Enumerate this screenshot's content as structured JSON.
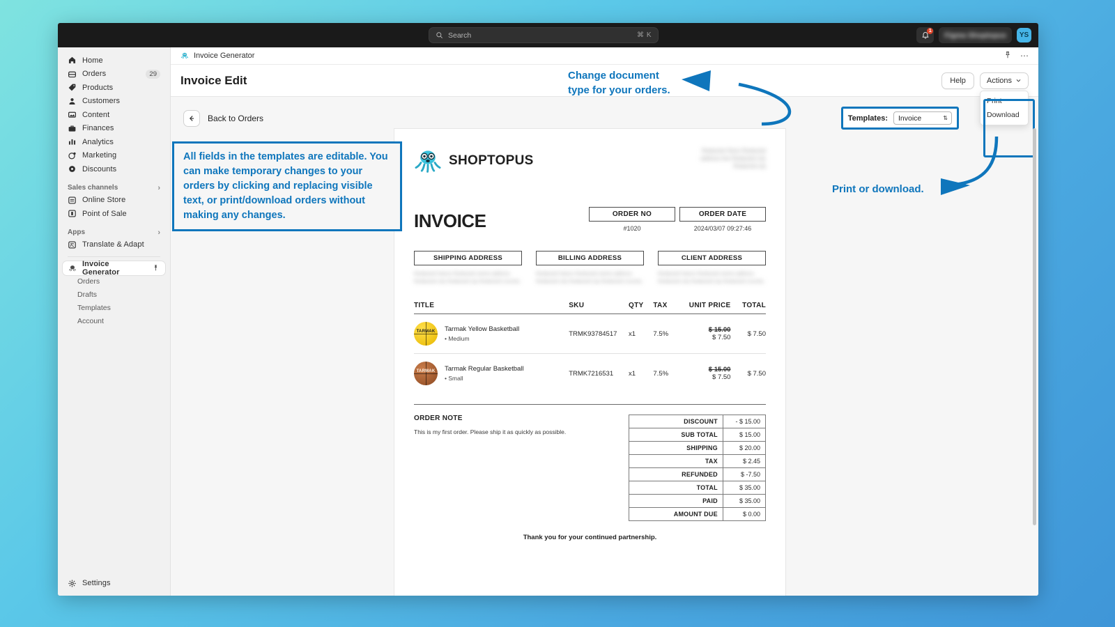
{
  "topbar": {
    "search_placeholder": "Search",
    "search_shortcut": "⌘ K",
    "notification_count": "1",
    "store_name": "Figma Shoptopus",
    "avatar_initials": "YS"
  },
  "sidebar": {
    "items": [
      {
        "label": "Home",
        "icon": "home-icon",
        "badge": ""
      },
      {
        "label": "Orders",
        "icon": "orders-icon",
        "badge": "29"
      },
      {
        "label": "Products",
        "icon": "products-icon",
        "badge": ""
      },
      {
        "label": "Customers",
        "icon": "customers-icon",
        "badge": ""
      },
      {
        "label": "Content",
        "icon": "content-icon",
        "badge": ""
      },
      {
        "label": "Finances",
        "icon": "finances-icon",
        "badge": ""
      },
      {
        "label": "Analytics",
        "icon": "analytics-icon",
        "badge": ""
      },
      {
        "label": "Marketing",
        "icon": "marketing-icon",
        "badge": ""
      },
      {
        "label": "Discounts",
        "icon": "discounts-icon",
        "badge": ""
      }
    ],
    "groups": [
      {
        "label": "Sales channels",
        "items": [
          {
            "label": "Online Store",
            "icon": "online-store-icon"
          },
          {
            "label": "Point of Sale",
            "icon": "point-of-sale-icon"
          }
        ]
      },
      {
        "label": "Apps",
        "items": [
          {
            "label": "Translate & Adapt",
            "icon": "translate-adapt-icon"
          }
        ]
      }
    ],
    "app": {
      "label": "Invoice Generator",
      "icon": "octopus-icon",
      "pin_icon": "pin-icon",
      "subitems": [
        "Orders",
        "Drafts",
        "Templates",
        "Account"
      ]
    },
    "settings": {
      "label": "Settings",
      "icon": "gear-icon"
    }
  },
  "app_header": {
    "breadcrumb": "Invoice Generator",
    "pin_icon": "pin-icon",
    "more_icon": "ellipsis-icon"
  },
  "page": {
    "title": "Invoice Edit",
    "help_label": "Help",
    "actions_label": "Actions",
    "actions_menu": [
      "Print",
      "Download"
    ],
    "back_label": "Back to Orders",
    "back_icon": "arrow-left-icon",
    "templates_label": "Templates:",
    "templates_value": "Invoice"
  },
  "annotations": [
    {
      "name": "templates-callout",
      "text": "Change document\ntype for your orders."
    },
    {
      "name": "fields-editable-callout",
      "text": "All fields in the templates are editable. You can make temporary changes to your orders by clicking and replacing visible text, or print/download orders without making any changes."
    },
    {
      "name": "print-download-callout",
      "text": "Print or download."
    }
  ],
  "annotation_color": "#0f76bc",
  "invoice": {
    "brand_name": "SHOPTOPUS",
    "heading": "INVOICE",
    "meta": [
      {
        "label": "ORDER NO",
        "value": "#1020"
      },
      {
        "label": "ORDER DATE",
        "value": "2024/03/07 09:27:46"
      }
    ],
    "addresses": [
      {
        "label": "SHIPPING ADDRESS",
        "lines": "Redacted Name\nRedacted street address\nRedacted city\nRedacted zip\nRedacted country"
      },
      {
        "label": "BILLING ADDRESS",
        "lines": "Redacted Name\nRedacted street address\nRedacted city\nRedacted zip\nRedacted country"
      },
      {
        "label": "CLIENT ADDRESS",
        "lines": "Redacted Name\nRedacted street address\nRedacted city\nRedacted zip\nRedacted country"
      }
    ],
    "merchant_blur": "Redacted Store\nRedacted address line\nRedacted city\nRedacted zip",
    "columns": [
      "TITLE",
      "SKU",
      "QTY",
      "TAX",
      "UNIT PRICE",
      "TOTAL"
    ],
    "line_items": [
      {
        "title": "Tarmak Yellow Basketball",
        "variant": "Medium",
        "ball": "yellow",
        "ball_text": "TARMAK",
        "sku": "TRMK93784517",
        "qty": "x1",
        "tax": "7.5%",
        "unit_price_old": "$ 15.00",
        "unit_price": "$ 7.50",
        "total": "$ 7.50"
      },
      {
        "title": "Tarmak Regular Basketball",
        "variant": "Small",
        "ball": "orange",
        "ball_text": "TARMAK",
        "sku": "TRMK7216531",
        "qty": "x1",
        "tax": "7.5%",
        "unit_price_old": "$ 15.00",
        "unit_price": "$ 7.50",
        "total": "$ 7.50"
      }
    ],
    "note_heading": "ORDER NOTE",
    "note_text": "This is my first order. Please ship it as quickly as possible.",
    "totals": [
      {
        "label": "DISCOUNT",
        "value": "- $ 15.00"
      },
      {
        "label": "SUB TOTAL",
        "value": "$ 15.00"
      },
      {
        "label": "SHIPPING",
        "value": "$ 20.00"
      },
      {
        "label": "TAX",
        "value": "$ 2.45"
      },
      {
        "label": "REFUNDED",
        "value": "$ -7.50"
      },
      {
        "label": "TOTAL",
        "value": "$ 35.00"
      },
      {
        "label": "PAID",
        "value": "$ 35.00"
      },
      {
        "label": "AMOUNT DUE",
        "value": "$ 0.00"
      }
    ],
    "footer": "Thank you for your continued partnership."
  }
}
